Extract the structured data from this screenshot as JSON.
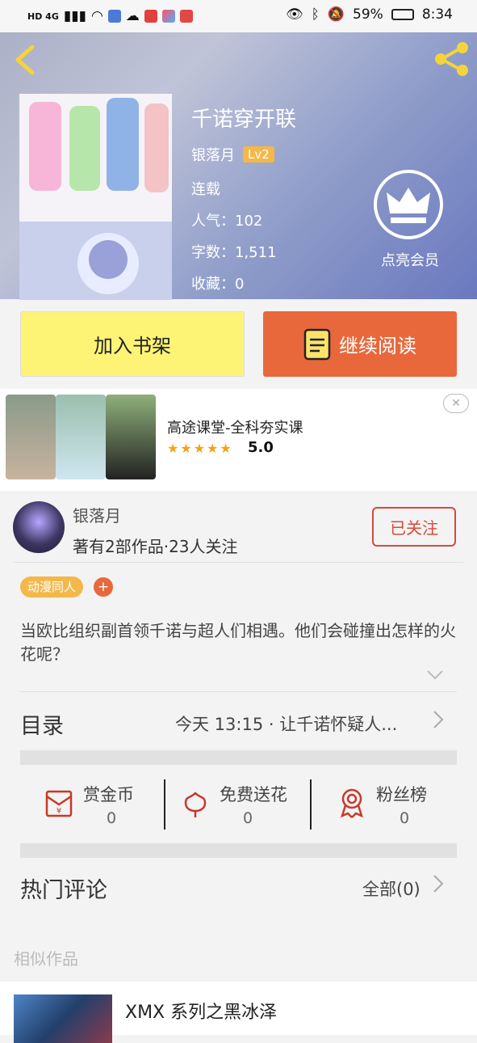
{
  "status_bar": {
    "left_text": "HD 4G",
    "battery": "59%",
    "time": "8:34"
  },
  "header": {
    "back_icon": "chevron-left-icon",
    "share_icon": "share-icon"
  },
  "book": {
    "title": "千诺穿开联",
    "author": "银落月",
    "level": "Lv2",
    "status": "连载",
    "popularity": "人气：102",
    "word_count": "字数：1,511",
    "favorites": "收藏：0",
    "vip_label": "点亮会员"
  },
  "actions": {
    "add_shelf": "加入书架",
    "continue_read": "继续阅读"
  },
  "ad": {
    "title": "高途课堂-全科夯实课",
    "stars": "★★★★★",
    "rating": "5.0",
    "close": "✕"
  },
  "author_block": {
    "name": "银落月",
    "stats": "著有2部作品·23人关注",
    "follow_label": "已关注"
  },
  "tags": {
    "tag1": "动漫同人",
    "add": "+"
  },
  "description": "当欧比组织副首领千诺与超人们相遇。他们会碰撞出怎样的火花呢？",
  "toc": {
    "label": "目录",
    "latest": "今天 13:15 · 让千诺怀疑人..."
  },
  "stats": {
    "coin_label": "赏金币",
    "coin_value": "0",
    "flower_label": "免费送花",
    "flower_value": "0",
    "fans_label": "粉丝榜",
    "fans_value": "0"
  },
  "comments": {
    "label": "热门评论",
    "all": "全部(0)"
  },
  "similar": {
    "label": "相似作品",
    "item_title": "XMX 系列之黑冰泽"
  },
  "colors": {
    "accent_orange": "#e8683b",
    "shelf_yellow": "#fdf476",
    "tag_yellow": "#f4b84a",
    "follow_red": "#d94a38"
  }
}
